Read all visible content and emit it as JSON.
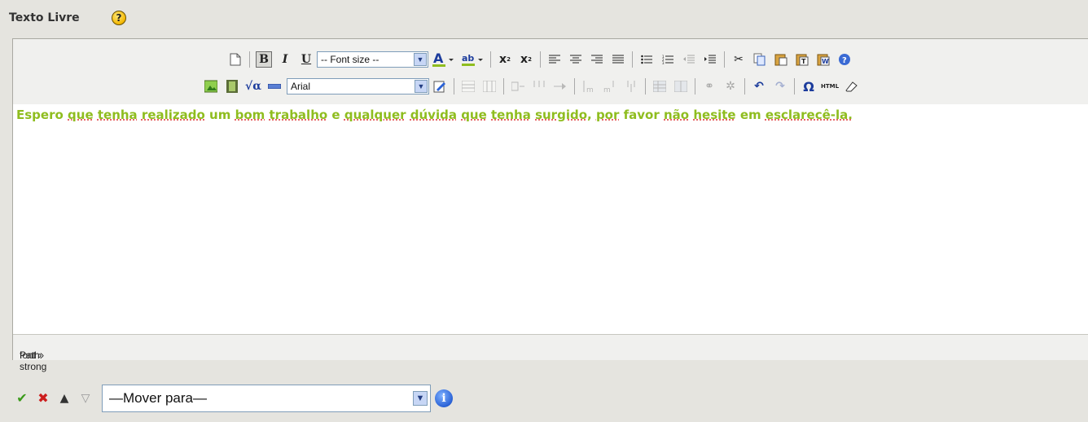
{
  "header": {
    "title": "Texto Livre",
    "help_icon": "question-icon"
  },
  "toolbar": {
    "row1": {
      "font_size_label": "-- Font size --",
      "icons": [
        "new-document-icon",
        "bold-icon",
        "italic-icon",
        "underline-icon",
        "font-color-icon",
        "highlight-icon",
        "subscript-icon",
        "superscript-icon",
        "align-left-icon",
        "align-center-icon",
        "align-right-icon",
        "justify-icon",
        "bullet-list-icon",
        "numbered-list-icon",
        "outdent-icon",
        "indent-icon",
        "cut-icon",
        "copy-icon",
        "paste-icon",
        "paste-text-icon",
        "paste-word-icon",
        "help-icon"
      ]
    },
    "row2": {
      "font_family_value": "Arial",
      "icons": [
        "image-icon",
        "media-icon",
        "equation-icon",
        "horizontal-rule-icon",
        "style-icon",
        "table-icon",
        "table-row-icon",
        "table-col-icon",
        "link-icon",
        "unlink-icon",
        "undo-icon",
        "redo-icon",
        "special-char-icon",
        "html-icon",
        "eraser-icon"
      ]
    }
  },
  "editor": {
    "content_words": [
      "Espero",
      "que",
      "tenha",
      "realizado",
      "um",
      "bom",
      "trabalho",
      "e",
      "qualquer",
      "dúvida",
      "que",
      "tenha",
      "surgido,",
      "por",
      "favor",
      "não",
      "hesite",
      "em",
      "esclarecê-la."
    ],
    "path_label": "Path:",
    "path_value": "font » strong"
  },
  "bottom": {
    "move_label": "—Mover para—"
  },
  "colors": {
    "content_text": "#8fbd1f",
    "background": "#e5e4df"
  }
}
